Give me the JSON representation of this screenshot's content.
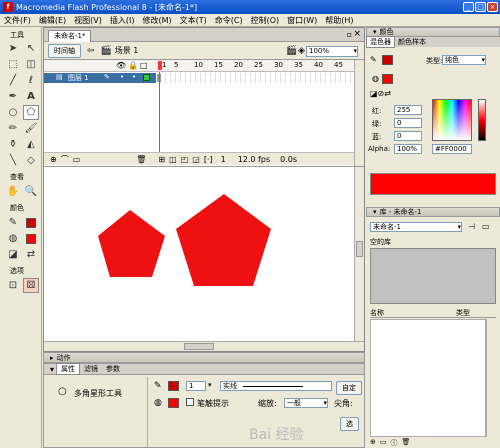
{
  "window": {
    "title": "Macromedia Flash Professional 8 - [未命名-1*]",
    "app_icon": "f"
  },
  "menu": [
    "文件(F)",
    "编辑(E)",
    "视图(V)",
    "插入(I)",
    "修改(M)",
    "文本(T)",
    "命令(C)",
    "控制(O)",
    "窗口(W)",
    "帮助(H)"
  ],
  "tools": {
    "title": "工具",
    "view_label": "查看",
    "colors_label": "颜色",
    "options_label": "选项",
    "icons": [
      "selection-arrow",
      "subselection-arrow",
      "free-transform",
      "fill-transform",
      "line",
      "lasso",
      "pen",
      "text",
      "oval",
      "rectangle",
      "pencil",
      "brush",
      "ink-bottle",
      "paint-bucket",
      "eyedropper",
      "eraser"
    ],
    "view_icons": [
      "hand",
      "zoom"
    ],
    "stroke_color": "#cc0000",
    "fill_color": "#ff0000"
  },
  "document": {
    "tab_label": "未命名-1*",
    "timeline_button": "时间轴",
    "scene_label": "场景 1",
    "zoom": "100%",
    "frame_numbers": [
      "1",
      "5",
      "10",
      "15",
      "20",
      "25",
      "30",
      "35",
      "40",
      "45"
    ],
    "layer_name": "图层 1",
    "current_frame": "1",
    "fps": "12.0 fps",
    "time": "0.0s",
    "shape_color": "#ee1111"
  },
  "color_panel": {
    "title": "颜色",
    "tab_mixer": "混色器",
    "tab_swatches": "颜色样本",
    "type_label": "类型:",
    "type_value": "纯色",
    "red_label": "红:",
    "red_value": "255",
    "green_label": "绿:",
    "green_value": "0",
    "blue_label": "蓝:",
    "blue_value": "0",
    "alpha_label": "Alpha:",
    "alpha_value": "100%",
    "hex_value": "#FF0000",
    "preview_color": "#ff0000"
  },
  "library_panel": {
    "title": "库 - 未命名-1",
    "doc_select": "未命名-1",
    "empty_label": "空的库",
    "col_name": "名称",
    "col_type": "类型"
  },
  "actions_bar": {
    "label": "动作"
  },
  "properties": {
    "tab_props": "属性",
    "tab_filters": "滤镜",
    "tab_params": "参数",
    "tool_name": "多角星形工具",
    "stroke_width": "1",
    "stroke_style": "实线",
    "custom_button": "自定",
    "stroke_hint": "笔触提示",
    "scale_label": "缩放:",
    "scale_value": "一般",
    "cap_label": "尖角:",
    "options_button": "选"
  },
  "watermark": "Bai 经验"
}
